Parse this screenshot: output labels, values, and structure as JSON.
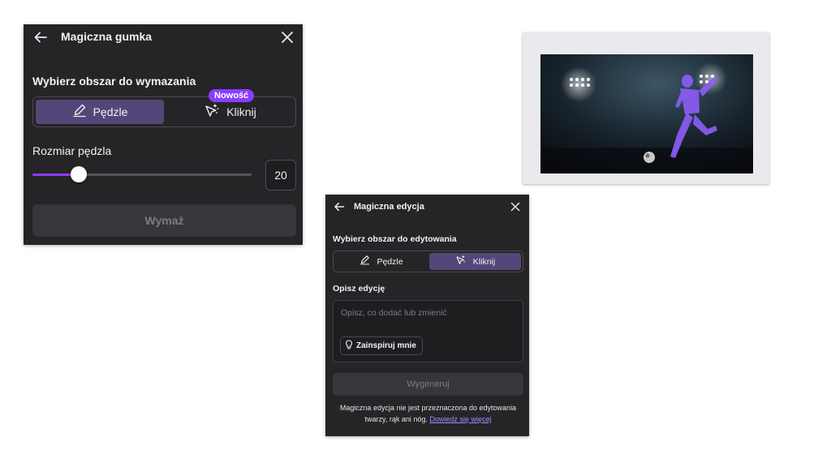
{
  "eraser_panel": {
    "title": "Magiczna gumka",
    "section_label": "Wybierz obszar do wymazania",
    "tabs": [
      {
        "label": "Pędzle",
        "icon": "brush-icon",
        "selected": true
      },
      {
        "label": "Kliknij",
        "icon": "magic-click-icon",
        "selected": false
      }
    ],
    "new_badge": "Nowość",
    "brush_size_label": "Rozmiar pędzla",
    "brush_size_value": "20",
    "brush_size_fraction": 0.21,
    "erase_button": "Wymaż"
  },
  "edit_panel": {
    "title": "Magiczna edycja",
    "section_label": "Wybierz obszar do edytowania",
    "tabs": [
      {
        "label": "Pędzle",
        "icon": "brush-icon",
        "selected": false
      },
      {
        "label": "Kliknij",
        "icon": "magic-click-icon",
        "selected": true
      }
    ],
    "describe_label": "Opisz edycję",
    "describe_placeholder": "Opisz, co dodać lub zmienić",
    "inspire_button": "Zainspiruj mnie",
    "generate_button": "Wygeneruj",
    "note_text": "Magiczna edycja nie jest przeznaczona do edytowania twarzy, rąk ani nóg.",
    "note_link": "Dowiedz się więcej"
  },
  "preview": {
    "subject": "soccer player kicking ball under stadium lights",
    "highlight_color": "#8b5cf6"
  },
  "colors": {
    "panel_bg": "#252528",
    "accent": "#8b3dff",
    "selected_tab": "#55467a"
  }
}
